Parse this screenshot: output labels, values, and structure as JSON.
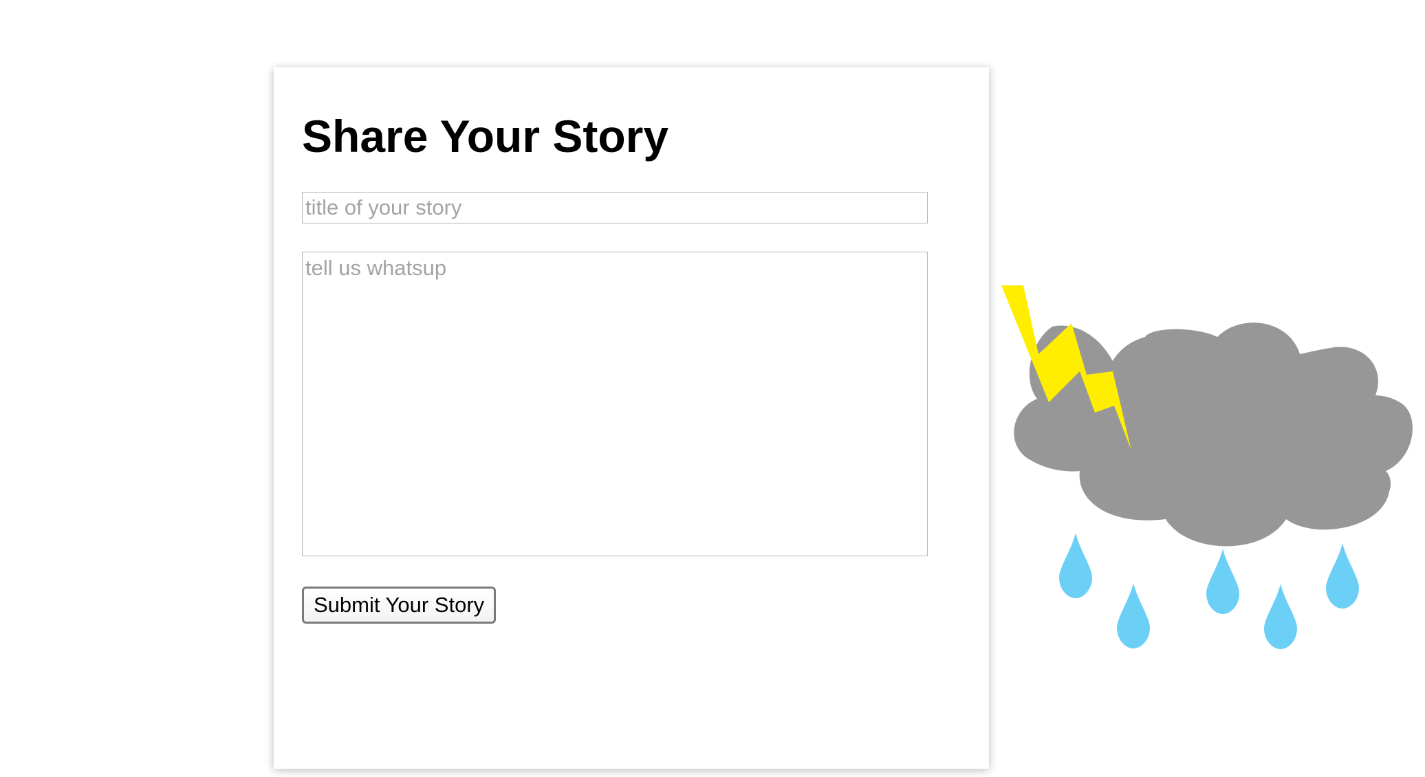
{
  "form": {
    "heading": "Share Your Story",
    "title_placeholder": "title of your story",
    "title_value": "",
    "body_placeholder": "tell us whatsup",
    "body_value": "",
    "submit_label": "Submit Your Story"
  },
  "illustration": {
    "icons": [
      "storm-cloud-icon",
      "lightning-bolt-icon",
      "raindrop-icon"
    ],
    "colors": {
      "cloud": "#979797",
      "lightning": "#ffee00",
      "rain": "#6ccff5"
    }
  }
}
